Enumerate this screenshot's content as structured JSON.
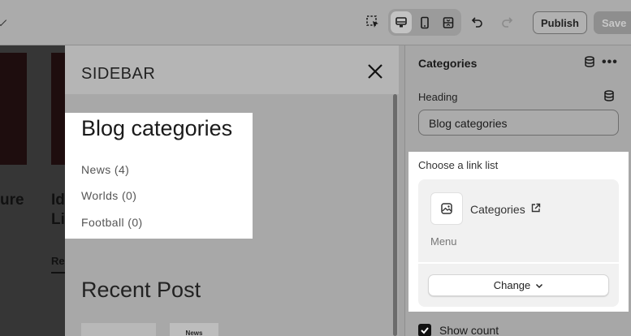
{
  "topbar": {
    "publish_label": "Publish",
    "save_label": "Save",
    "icons": [
      "chevron-icon",
      "inspect-icon",
      "desktop-icon",
      "mobile-icon",
      "fullwidth-icon",
      "undo-icon",
      "redo-icon"
    ]
  },
  "preview": {
    "left_text_1": "ure",
    "left_text_2a": "Id",
    "left_text_2b": "Li",
    "left_link": "Re"
  },
  "drawer": {
    "title": "SIDEBAR",
    "categories_heading": "Blog categories",
    "categories": [
      {
        "label": "News (4)"
      },
      {
        "label": "Worlds (0)"
      },
      {
        "label": "Football (0)"
      }
    ],
    "recent_title": "Recent Post",
    "recent_thumb_label": "News"
  },
  "panel": {
    "title": "Categories",
    "heading_label": "Heading",
    "heading_value": "Blog categories",
    "link_list_label": "Choose a link list",
    "link_name": "Categories",
    "link_subtitle": "Menu",
    "change_label": "Change",
    "show_count_label": "Show count",
    "show_count_checked": true
  }
}
